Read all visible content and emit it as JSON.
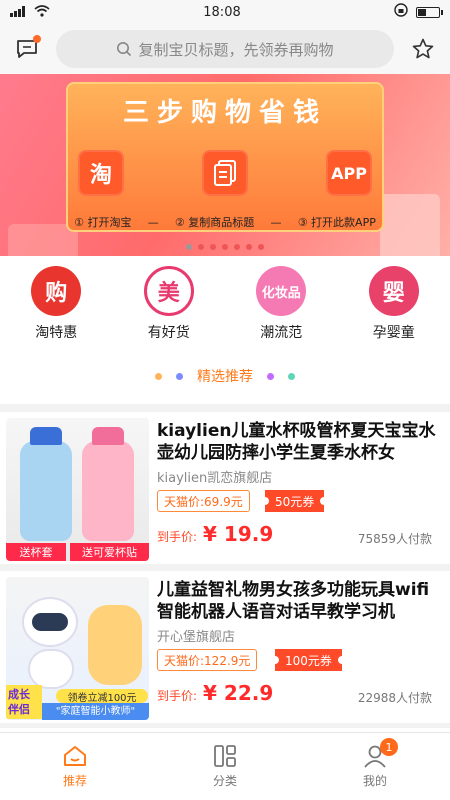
{
  "status_bar": {
    "signal": "5G",
    "time": "18:08"
  },
  "header": {
    "search_placeholder": "复制宝贝标题，先领券再购物"
  },
  "banner": {
    "title": "三步购物省钱",
    "icons": [
      "淘",
      "",
      "APP"
    ],
    "steps": [
      "① 打开淘宝",
      "② 复制商品标题",
      "③ 打开此款APP"
    ]
  },
  "categories": [
    {
      "label": "淘特惠",
      "glyph": "购",
      "color": "#e8352e"
    },
    {
      "label": "有好货",
      "glyph": "美",
      "color": "#e83a6e"
    },
    {
      "label": "潮流范",
      "glyph": "化妆品",
      "color": "#f57ab4"
    },
    {
      "label": "孕婴童",
      "glyph": "婴",
      "color": "#e8416a"
    }
  ],
  "section": {
    "title": "精选推荐"
  },
  "products": [
    {
      "title": "kiaylien儿童水杯吸管杯夏天宝宝水壶幼儿园防摔小学生夏季水杯女",
      "shop": "kiaylien凯恋旗舰店",
      "tmall_price": "天猫价:69.9元",
      "coupon": "50元券",
      "final_label": "到手价:",
      "final_price": "¥ 19.9",
      "sold": "75859人付款",
      "img_labels": [
        "送杯套",
        "送可爱杯贴"
      ]
    },
    {
      "title": "儿童益智礼物男女孩多功能玩具wifi智能机器人语音对话早教学习机",
      "shop": "开心堡旗舰店",
      "tmall_price": "天猫价:122.9元",
      "coupon": "100元券",
      "final_label": "到手价:",
      "final_price": "¥ 22.9",
      "sold": "22988人付款",
      "img_labels": [
        "成长伴侣",
        "领卷立减100元",
        "\"家庭智能小教师\""
      ]
    }
  ],
  "bottom_nav": {
    "items": [
      {
        "label": "推荐",
        "icon": "home-icon",
        "active": true
      },
      {
        "label": "分类",
        "icon": "category-icon",
        "active": false
      },
      {
        "label": "我的",
        "icon": "user-icon",
        "active": false
      }
    ],
    "badge": "1"
  },
  "colors": {
    "accent": "#ff7a1a",
    "price": "#ff2a2a",
    "coupon": "#ff4a2a"
  }
}
